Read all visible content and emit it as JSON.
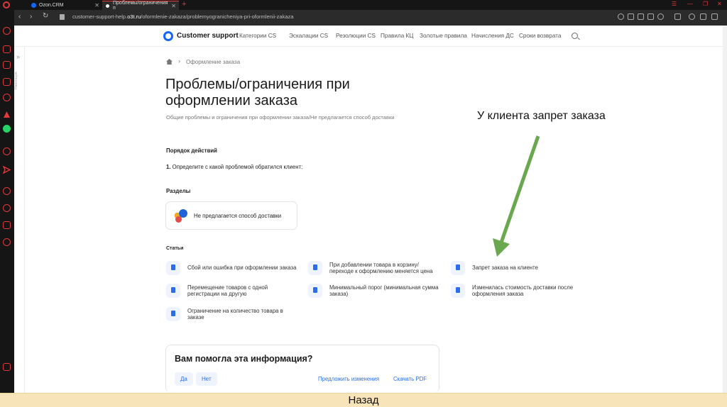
{
  "browser": {
    "tabs": [
      {
        "label": "Ozon.CRM"
      },
      {
        "label": "Проблемы/ограничения п"
      }
    ],
    "url_prefix": "customer-support-help.",
    "url_domain": "o3t.ru",
    "url_path": "/oformlenie-zakaza/problemyogranicheniya-pri-oformlenii-zakaza"
  },
  "header": {
    "brand": "Customer support",
    "nav": [
      "Категории CS",
      "Эскалации CS",
      "Резолюции CS",
      "Правила КЦ",
      "Золотые правила",
      "Начисления ДС",
      "Сроки возврата"
    ]
  },
  "rail": {
    "label": "Навигация"
  },
  "breadcrumb": {
    "current": "Оформление заказа"
  },
  "page": {
    "title": "Проблемы/ограничения при оформлении заказа",
    "subtitle": "Общие проблемы и ограничения при оформлении заказа/Не предлагается способ доставки",
    "actions_heading": "Порядок действий",
    "step_num": "1.",
    "step_text": " Определите с какой проблемой обратился клиент:",
    "sections_heading": "Разделы",
    "section_card": "Не предлагается способ доставки",
    "articles_heading": "Статьи",
    "articles": [
      "Сбой или ошибка при оформлении заказа",
      "При добавлении товара в корзину/ переходе к оформлению меняется цена",
      "Запрет заказа на клиенте",
      "Перемещение товаров с одной регистрации на другую",
      "Минимальный порог (минимальная сумма заказа)",
      "Изменилась стоимость доставки после оформления заказа",
      "Ограничение на количество товара в заказе"
    ]
  },
  "feedback": {
    "title": "Вам помогла эта информация?",
    "yes": "Да",
    "no": "Нет",
    "suggest": "Предложить изменения",
    "pdf": "Скачать PDF"
  },
  "annotation": {
    "text": "У клиента запрет заказа",
    "arrow_color": "#6aa84f"
  },
  "footer_bar": {
    "label": "Назад"
  },
  "colors": {
    "accent": "#1565ff",
    "link": "#2b6de8",
    "browser_red": "#e03a3a",
    "back_bar": "#f7e5b9"
  }
}
